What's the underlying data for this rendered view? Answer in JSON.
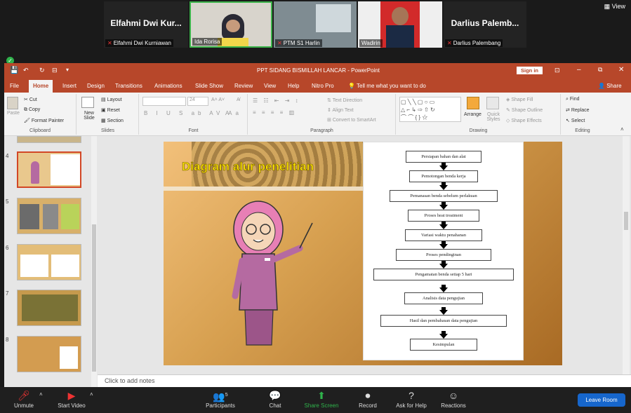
{
  "zoom": {
    "view_label": "View",
    "participants": [
      {
        "big_name": "Elfahmi  Dwi  Kur...",
        "label": "Elfahmi Dwi Kurniawan",
        "muted": true
      },
      {
        "big_name": "",
        "label": "Ida Rorisa",
        "muted": false
      },
      {
        "big_name": "",
        "label": "PTM S1 Harlin",
        "muted": true
      },
      {
        "big_name": "",
        "label": "Wadirin",
        "muted": false
      },
      {
        "big_name": "Darlius   Palemb...",
        "label": "Darlius  Palembang",
        "muted": true
      }
    ],
    "toolbar": {
      "unmute": "Unmute",
      "start_video": "Start Video",
      "participants": "Participants",
      "participants_count": "5",
      "chat": "Chat",
      "share_screen": "Share Screen",
      "record": "Record",
      "ask_for_help": "Ask for Help",
      "reactions": "Reactions",
      "leave_room": "Leave Room"
    }
  },
  "ppt": {
    "window_title": "PPT SIDANG BISMILLAH LANCAR  -  PowerPoint",
    "sign_in": "Sign in",
    "tabs": [
      "File",
      "Home",
      "Insert",
      "Design",
      "Transitions",
      "Animations",
      "Slide Show",
      "Review",
      "View",
      "Help",
      "Nitro Pro"
    ],
    "tell_me": "Tell me what you want to do",
    "share": "Share",
    "ribbon": {
      "clipboard": {
        "paste": "Paste",
        "cut": "Cut",
        "copy": "Copy",
        "format_painter": "Format Painter",
        "group": "Clipboard"
      },
      "slides": {
        "new_slide": "New Slide",
        "layout": "Layout",
        "reset": "Reset",
        "section": "Section",
        "group": "Slides"
      },
      "font": {
        "size": "24",
        "group": "Font"
      },
      "paragraph": {
        "text_direction": "Text Direction",
        "align_text": "Align Text",
        "convert_smartart": "Convert to SmartArt",
        "group": "Paragraph"
      },
      "drawing": {
        "arrange": "Arrange",
        "quick_styles": "Quick Styles",
        "shape_fill": "Shape Fill",
        "shape_outline": "Shape Outline",
        "shape_effects": "Shape Effects",
        "group": "Drawing"
      },
      "editing": {
        "find": "Find",
        "replace": "Replace",
        "select": "Select",
        "group": "Editing"
      }
    },
    "thumbnails": [
      {
        "num": "4",
        "selected": true
      },
      {
        "num": "5",
        "selected": false
      },
      {
        "num": "6",
        "selected": false
      },
      {
        "num": "7",
        "selected": false
      },
      {
        "num": "8",
        "selected": false
      }
    ],
    "notes_placeholder": "Click to add notes",
    "slide": {
      "title": "Diagram alur penelitian",
      "steps": [
        "Persiapan bahan dan alat",
        "Pemotongan benda kerja",
        "Pemanasan benda sebelum perlakuan",
        "Proses heat treatment",
        "Variasi waktu penahanan",
        "Proses pendinginan",
        "Pengamatan benda setiap 5 hari",
        "Analisis data pengujian",
        "Hasil dan pembahasan data pengujian",
        "Kesimpulan"
      ]
    }
  }
}
